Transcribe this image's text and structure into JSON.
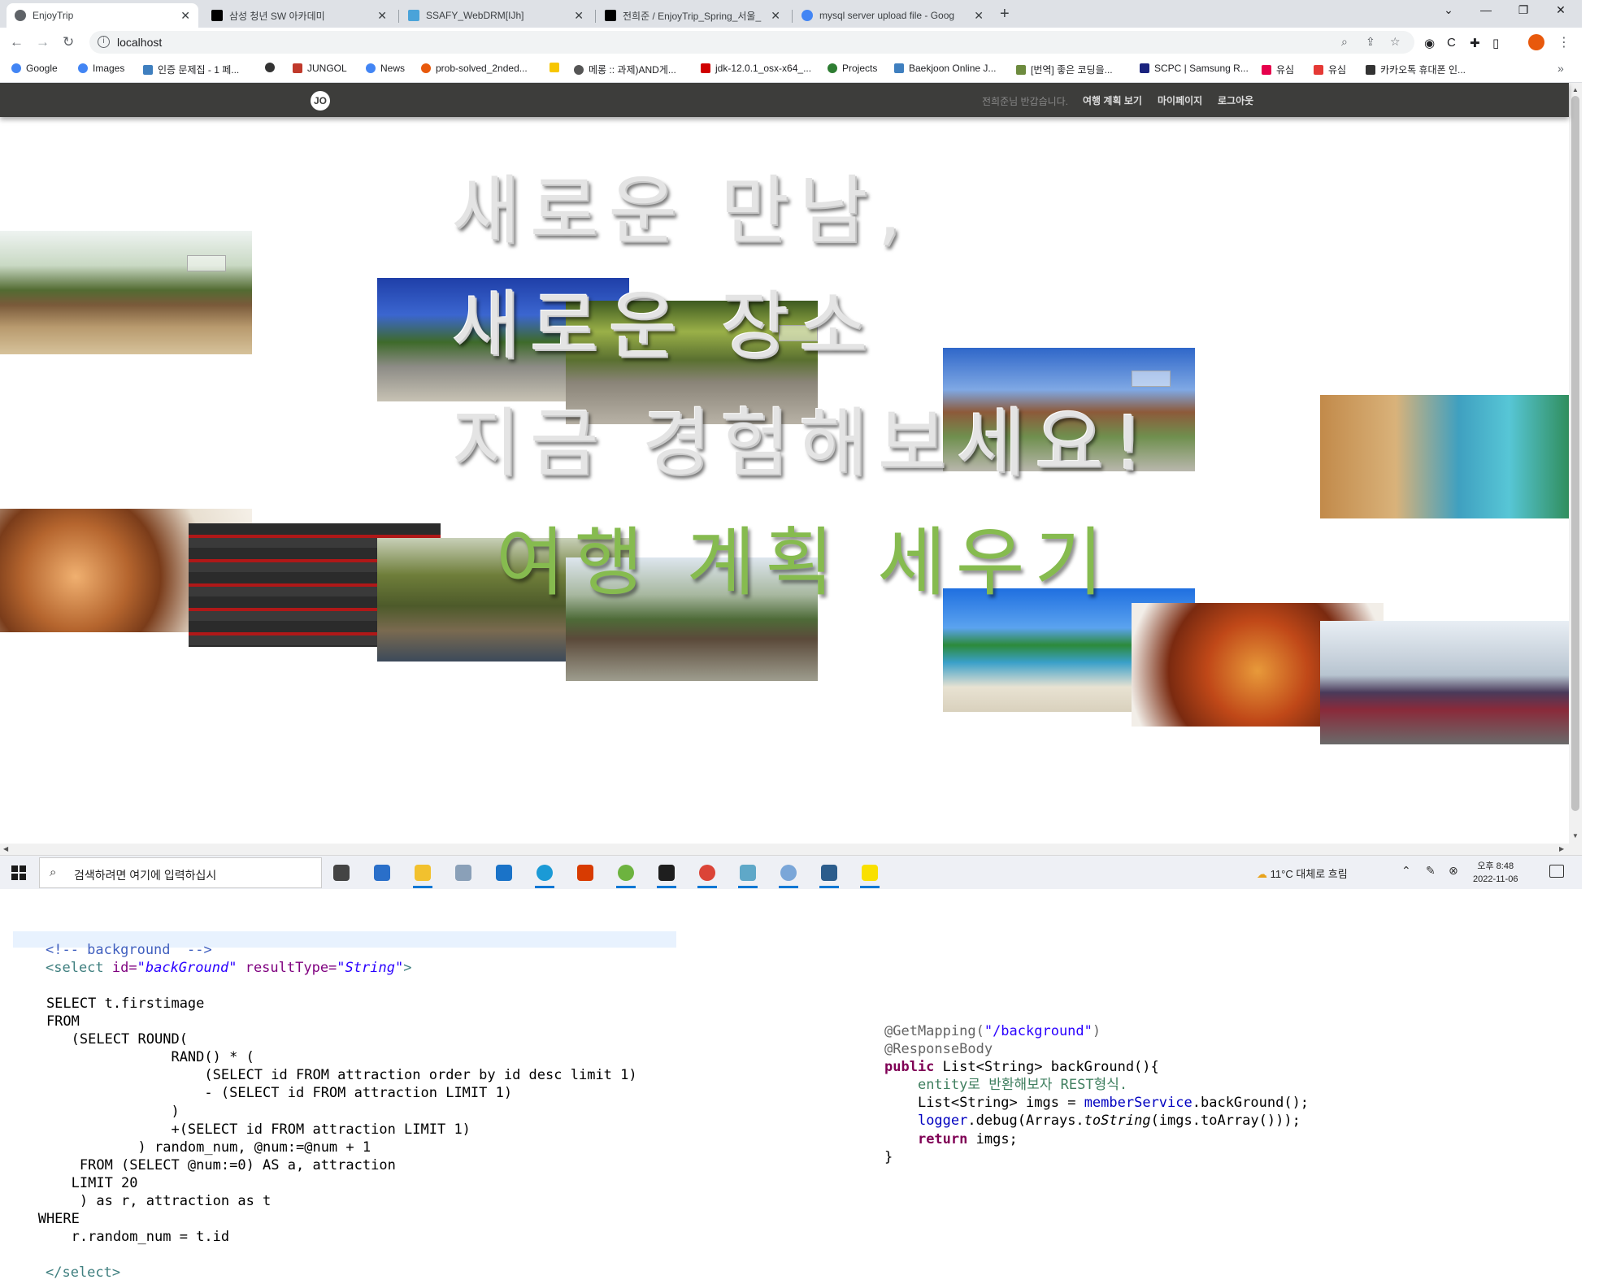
{
  "browser": {
    "tabs": [
      {
        "title": "EnjoyTrip",
        "active": true,
        "icon": "globe-icon"
      },
      {
        "title": "삼성 청년 SW 아카데미",
        "active": false,
        "icon": "notion-icon"
      },
      {
        "title": "SSAFY_WebDRM[IJh]",
        "active": false,
        "icon": "ssafy-icon"
      },
      {
        "title": "전희준 / EnjoyTrip_Spring_서울_",
        "active": false,
        "icon": "notion-icon"
      },
      {
        "title": "mysql server upload file - Goog",
        "active": false,
        "icon": "google-icon"
      }
    ],
    "new_tab": "+",
    "url": "localhost",
    "bookmarks": [
      {
        "label": "Google",
        "color": "#4285f4"
      },
      {
        "label": "Images",
        "color": "#4285f4"
      },
      {
        "label": "인증 문제집 - 1 페...",
        "color": "#3f7fbf"
      },
      {
        "label": "",
        "color": "#333333"
      },
      {
        "label": "JUNGOL",
        "color": "#c0392b"
      },
      {
        "label": "News",
        "color": "#4285f4"
      },
      {
        "label": "prob-solved_2nded...",
        "color": "#e8590c"
      },
      {
        "label": "",
        "color": "#f7c600"
      },
      {
        "label": "메롱 :: 과제)AND게...",
        "color": "#555555"
      },
      {
        "label": "jdk-12.0.1_osx-x64_...",
        "color": "#d00000"
      },
      {
        "label": "Projects",
        "color": "#2e7d32"
      },
      {
        "label": "Baekjoon Online J...",
        "color": "#3f7fbf"
      },
      {
        "label": "[번역] 좋은 코딩을...",
        "color": "#6d8b3e"
      },
      {
        "label": "SCPC | Samsung R...",
        "color": "#1a237e"
      },
      {
        "label": "유심",
        "color": "#e6004c"
      },
      {
        "label": "유심",
        "color": "#e53935"
      },
      {
        "label": "카카오톡 휴대폰 인...",
        "color": "#333333"
      }
    ]
  },
  "site": {
    "logo": "JO",
    "greeting": "전희준님 반갑습니다.",
    "nav": [
      "여행 계획 보기",
      "마이페이지",
      "로그아웃"
    ],
    "hero_lines": [
      "새로운 만남,",
      "새로운 장소",
      "지금 경험해보세요!"
    ],
    "cta": "여행 계획 세우기",
    "tiles": [
      {
        "name": "hanok-village-photo",
        "bg": "linear-gradient(180deg,#eef3f1 0%,#c9d9c4 28%,#526b32 48%,#7a5a3a 60%,#b89a6e 78%,#d6c29a 100%)",
        "broken_img": true
      },
      {
        "name": "stone-stairs-photo",
        "bg": "linear-gradient(180deg,#1f3fa8 0%,#3b66d0 30%,#3e6a2a 52%,#8d8c86 72%,#c7c2b4 100%)",
        "broken_img": false
      },
      {
        "name": "forest-gravel-photo",
        "bg": "linear-gradient(180deg,#3e5a20 0%,#9ab048 25%,#5a7030 48%,#8a8478 66%,#b8b2a6 100%)",
        "broken_img": true
      },
      {
        "name": "rusty-building-photo",
        "bg": "linear-gradient(180deg,#2f67c9 0%,#7fa8e4 34%,#8d5a3a 52%,#6f8f4e 72%,#b9b7ad 100%)",
        "broken_img": true
      },
      {
        "name": "waterpark-photo",
        "bg": "linear-gradient(90deg,#c28a4a 0%,#d9b27a 30%,#3fa0c0 55%,#57c6d6 75%,#2e8b57 100%)",
        "broken_img": false
      },
      {
        "name": "brunch-food-photo",
        "bg": "radial-gradient(circle at 30% 55%,#f0b070 0%,#b5652e 28%,#7a3c1a 45%,#e8dfd0 70%,#f5f0e8 100%)",
        "broken_img": false
      },
      {
        "name": "hotel-building-photo",
        "bg": "repeating-linear-gradient(180deg,#2b2b2b 0px,#2b2b2b 14px,#b01818 14px,#b01818 18px,#3a3a3a 18px,#3a3a3a 30px)",
        "broken_img": false
      },
      {
        "name": "suspension-bridge-photo",
        "bg": "linear-gradient(180deg,#c8d0b8 0%,#6f7e3a 30%,#4d5a2a 55%,#7a6a50 75%,#3c4a5a 100%)",
        "broken_img": false
      },
      {
        "name": "camping-tent-photo",
        "bg": "linear-gradient(180deg,#dde6ee 0%,#a8b8a0 30%,#4e6b38 50%,#5b4a3a 66%,#9e9d8e 100%)",
        "broken_img": false
      },
      {
        "name": "beach-photo",
        "bg": "linear-gradient(180deg,#1f6fe0 0%,#5ba3ef 32%,#2c8a3a 46%,#3aa0c9 60%,#e8e2d2 80%,#d9d1bd 100%)",
        "broken_img": false
      },
      {
        "name": "noodles-photo",
        "bg": "radial-gradient(circle at 50% 55%,#e89a3a 0%,#c04818 35%,#7a2a10 62%,#f2eee8 90%)",
        "broken_img": false
      },
      {
        "name": "street-market-photo",
        "bg": "linear-gradient(180deg,#e8eef4 0%,#c8d2dc 30%,#b7c4d0 44%,#4a3a5a 58%,#8a2a3a 72%,#6a6a6a 100%)",
        "broken_img": false
      }
    ]
  },
  "taskbar": {
    "search_placeholder": "검색하려면 여기에 입력하십시",
    "apps": [
      {
        "name": "task-view-icon",
        "color": "#444444",
        "running": false
      },
      {
        "name": "store-icon",
        "color": "#2a6fc9",
        "running": false
      },
      {
        "name": "file-explorer-icon",
        "color": "#f2c12e",
        "running": true
      },
      {
        "name": "photos-icon",
        "color": "#8aa0b8",
        "running": false
      },
      {
        "name": "mail-icon",
        "color": "#1a73c8",
        "running": false
      },
      {
        "name": "edge-icon",
        "color": "#1b9ad6",
        "running": true
      },
      {
        "name": "office-icon",
        "color": "#d83b01",
        "running": false
      },
      {
        "name": "spring-tool-icon",
        "color": "#6db33f",
        "running": true
      },
      {
        "name": "terminal-icon",
        "color": "#1e1e1e",
        "running": true
      },
      {
        "name": "chrome-icon",
        "color": "#db4437",
        "running": true
      },
      {
        "name": "notes-icon",
        "color": "#5fa8c8",
        "running": true
      },
      {
        "name": "paint-icon",
        "color": "#7aa6d8",
        "running": true
      },
      {
        "name": "vscode-icon",
        "color": "#2c5d8c",
        "running": true
      },
      {
        "name": "kakaotalk-icon",
        "color": "#f9e000",
        "running": true
      }
    ],
    "weather": "11°C 대체로 흐림",
    "time": "오후 8:48",
    "date": "2022-11-06"
  },
  "code": {
    "sql_comment": "<!-- background  -->",
    "sql_open_tag": "<select",
    "sql_attr_id": "id=",
    "sql_attr_id_val": "\"backGround\"",
    "sql_attr_rt": "resultType=",
    "sql_attr_rt_val": "\"String\"",
    "sql_open_end": ">",
    "sql_lines": [
      "    SELECT t.firstimage",
      "    FROM",
      "       (SELECT ROUND(",
      "                   RAND() * (",
      "                       (SELECT id FROM attraction order by id desc limit 1)",
      "                       - (SELECT id FROM attraction LIMIT 1)",
      "                   )",
      "                   +(SELECT id FROM attraction LIMIT 1)",
      "               ) random_num, @num:=@num + 1",
      "        FROM (SELECT @num:=0) AS a, attraction",
      "       LIMIT 20",
      "        ) as r, attraction as t",
      "   WHERE",
      "       r.random_num = t.id"
    ],
    "sql_close": "</select>",
    "java_annotation1": "@GetMapping(",
    "java_annotation1_arg": "\"/background\"",
    "java_annotation1_end": ")",
    "java_annotation2": "@ResponseBody",
    "java_public": "public",
    "java_signature": " List<String> backGround(){",
    "java_comment": "entity로 반환해보자 REST형식.",
    "java_line1_a": "List<String> ",
    "java_line1_var": "imgs",
    "java_line1_b": " = ",
    "java_line1_field": "memberService",
    "java_line1_c": ".backGround();",
    "java_line2_field": "logger",
    "java_line2_a": ".debug(Arrays.",
    "java_line2_static": "toString",
    "java_line2_b": "(",
    "java_line2_var": "imgs",
    "java_line2_c": ".toArray()));",
    "java_return": "return",
    "java_return_rest": " imgs;",
    "java_close": "}"
  }
}
